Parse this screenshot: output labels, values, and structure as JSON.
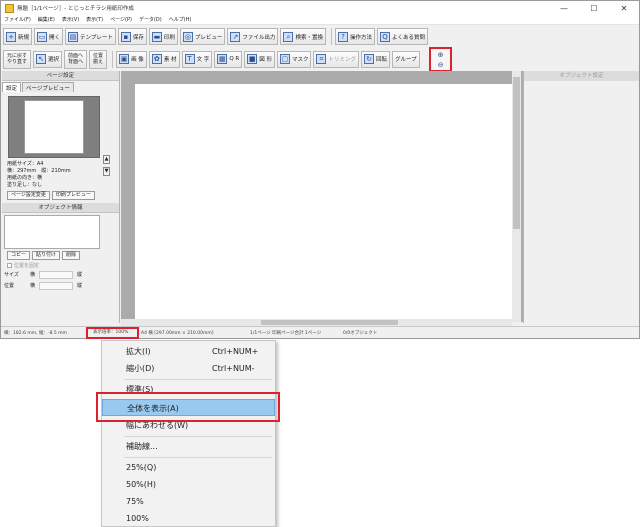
{
  "window": {
    "title": "無題［1/1ページ］- とじっとチラシ用紙印作成",
    "controls": [
      "—",
      "☐",
      "✕"
    ]
  },
  "menubar": [
    "ファイル(F)",
    "編集(E)",
    "表示(V)",
    "表示(T)",
    "ページ(P)",
    "データ(D)",
    "ヘルプ(H)"
  ],
  "toolbar1": {
    "new": "新規",
    "open": "開く",
    "template": "テンプレート",
    "save": "保存",
    "print": "印刷",
    "preview": "プレビュー",
    "file_output": "ファイル出力",
    "search_replace": "検索・置換",
    "how_to": "操作方法",
    "faq": "よくある質問"
  },
  "toolbar2": {
    "undo_line1": "元に戻す",
    "undo_line2": "やり直す",
    "select": "選択",
    "order_line1": "前面へ",
    "order_line2": "背面へ",
    "align_line1": "位置",
    "align_line2": "揃え",
    "image": "画 像",
    "material": "素 材",
    "text": "文 字",
    "qr": "Q R",
    "shape": "図 形",
    "mask": "マスク",
    "trim": "トリミング",
    "rotate": "回転",
    "group": "グループ"
  },
  "page_settings": {
    "header": "ページ設定",
    "tabs": [
      "設定",
      "ページプレビュー"
    ],
    "paper_size": "用紙サイズ：A4",
    "dimensions": "横：297mm　縦：210mm",
    "orientation": "用紙の向き：横",
    "bleed": "塗り足し：なし",
    "change_button": "ページ設定変更",
    "print_preview_button": "印刷プレビュー"
  },
  "object_info": {
    "header": "オブジェクト情報",
    "copy": "コピー",
    "paste": "貼り付け",
    "delete": "削除",
    "fix_position": "位置を固定",
    "size_label": "サイズ",
    "position_label": "位置",
    "width_label": "横",
    "height_label": "縦"
  },
  "object_settings": {
    "header": "オブジェクト設定"
  },
  "status": {
    "cursor": "横：182.6 mm, 縦：-8.5 mm",
    "zoom": "表示倍率：100%",
    "paper": "A4 横 [297.00mm × 210.00mm]",
    "pages": "1/1ページ 印刷ページ合計 1ページ",
    "objects": "0/0オブジェクト"
  },
  "context_menu": {
    "zoom_in": "拡大(I)",
    "zoom_in_sc": "Ctrl+NUM+",
    "zoom_out": "縮小(D)",
    "zoom_out_sc": "Ctrl+NUM-",
    "standard": "標準(S)",
    "fit_all": "全体を表示(A)",
    "fit_width": "幅にあわせる(W)",
    "guides": "補助線...",
    "z25": "25%(Q)",
    "z50": "50%(H)",
    "z75": "75%",
    "z100": "100%"
  },
  "colors": {
    "highlight": "#d9232e",
    "selection": "#99c9ef"
  }
}
